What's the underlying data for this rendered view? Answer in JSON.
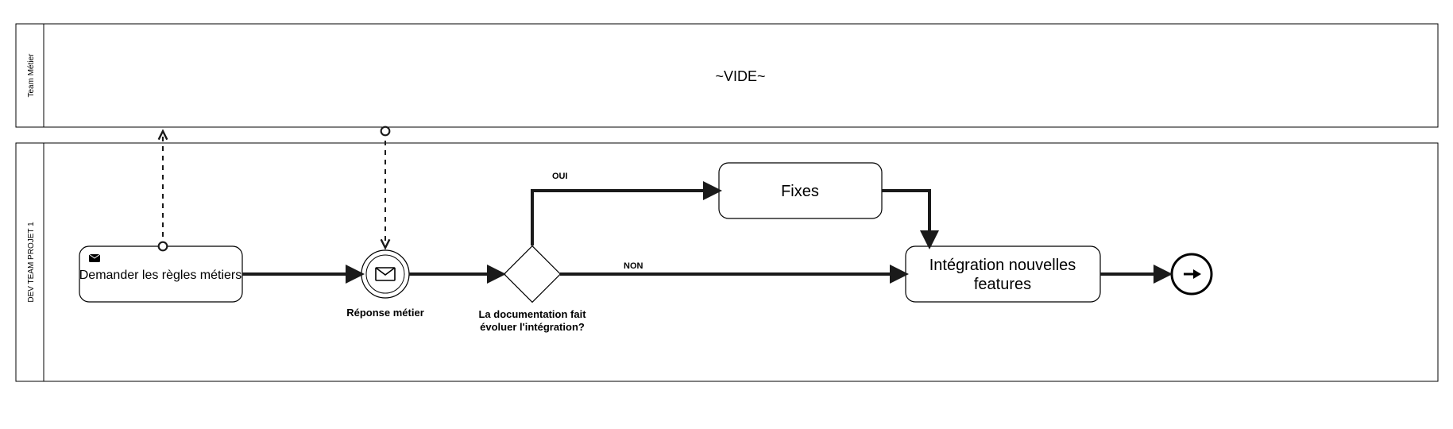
{
  "lanes": {
    "top": {
      "title": "Team Métier",
      "placeholder": "~VIDE~"
    },
    "bottom": {
      "title": "DEV TEAM PROJET 1"
    }
  },
  "nodes": {
    "task_request": {
      "label": "Demander les règles métiers"
    },
    "event_response": {
      "caption": "Réponse métier"
    },
    "gateway_doc": {
      "caption_l1": "La documentation fait",
      "caption_l2": "évoluer l'intégration?"
    },
    "task_fixes": {
      "label": "Fixes"
    },
    "task_integration": {
      "label_l1": "Intégration nouvelles",
      "label_l2": "features"
    }
  },
  "edges": {
    "yes": "OUI",
    "no": "NON"
  }
}
